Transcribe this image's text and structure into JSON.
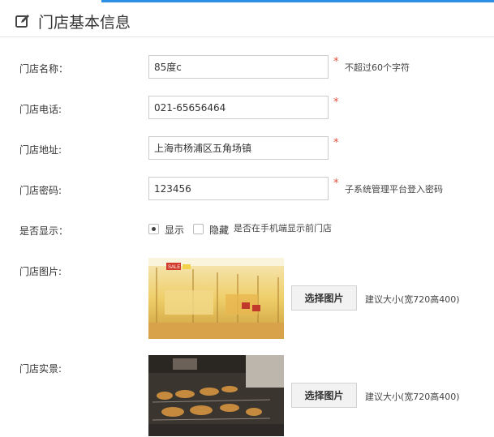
{
  "page": {
    "title": "门店基本信息",
    "title_icon": "edit-icon"
  },
  "form": {
    "name": {
      "label": "门店名称：",
      "value": "85度c",
      "required": "*",
      "hint": "不超过60个字符"
    },
    "phone": {
      "label": "门店电话:",
      "value": "021-65656464",
      "required": "*"
    },
    "address": {
      "label": "门店地址:",
      "value": "上海市杨浦区五角场镇",
      "required": "*"
    },
    "password": {
      "label": "门店密码:",
      "value": "123456",
      "required": "*",
      "hint": "子系统管理平台登入密码"
    },
    "display": {
      "label": "是否显示：",
      "options": [
        {
          "label": "显示",
          "selected": true
        },
        {
          "label": "隐藏",
          "selected": false
        }
      ],
      "hint": "是否在手机端显示前门店"
    },
    "store_image": {
      "label": "门店图片:",
      "button": "选择图片",
      "hint": "建议大小(宽720高400)",
      "badge": "SALE"
    },
    "store_scene": {
      "label": "门店实景:",
      "button": "选择图片",
      "hint": "建议大小(宽720高400)"
    }
  },
  "colors": {
    "accent_blue": "#2f8fe4",
    "required_red": "#e54f3b"
  }
}
